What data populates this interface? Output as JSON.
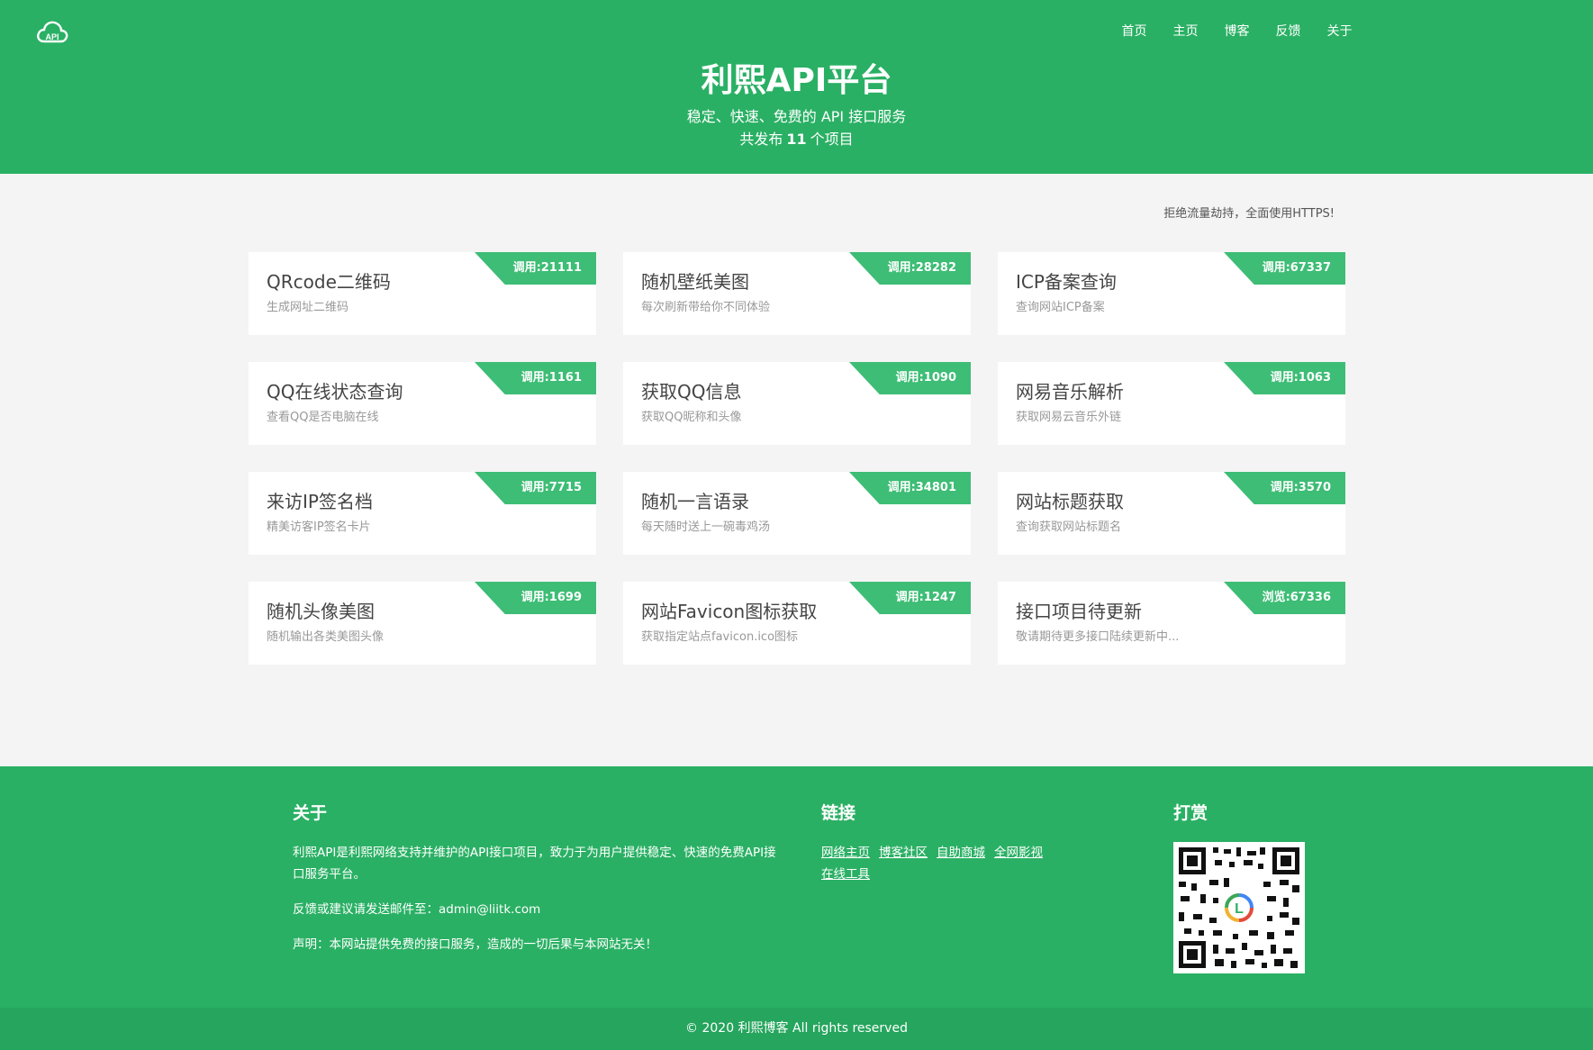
{
  "header": {
    "logo_text": "API",
    "nav": [
      "首页",
      "主页",
      "博客",
      "反馈",
      "关于"
    ],
    "title": "利熙API平台",
    "subtitle": "稳定、快速、免费的 API 接口服务",
    "count_prefix": "共发布",
    "count_value": "11",
    "count_suffix": "个项目"
  },
  "notice": "拒绝流量劫持，全面使用HTTPS!",
  "cards": [
    {
      "name": "QRcode二维码",
      "desc": "生成网址二维码",
      "badge": "调用:21111"
    },
    {
      "name": "随机壁纸美图",
      "desc": "每次刷新带给你不同体验",
      "badge": "调用:28282"
    },
    {
      "name": "ICP备案查询",
      "desc": "查询网站ICP备案",
      "badge": "调用:67337"
    },
    {
      "name": "QQ在线状态查询",
      "desc": "查看QQ是否电脑在线",
      "badge": "调用:1161"
    },
    {
      "name": "获取QQ信息",
      "desc": "获取QQ昵称和头像",
      "badge": "调用:1090"
    },
    {
      "name": "网易音乐解析",
      "desc": "获取网易云音乐外链",
      "badge": "调用:1063"
    },
    {
      "name": "来访IP签名档",
      "desc": "精美访客IP签名卡片",
      "badge": "调用:7715"
    },
    {
      "name": "随机一言语录",
      "desc": "每天随时送上一碗毒鸡汤",
      "badge": "调用:34801"
    },
    {
      "name": "网站标题获取",
      "desc": "查询获取网站标题名",
      "badge": "调用:3570"
    },
    {
      "name": "随机头像美图",
      "desc": "随机输出各类美图头像",
      "badge": "调用:1699"
    },
    {
      "name": "网站Favicon图标获取",
      "desc": "获取指定站点favicon.ico图标",
      "badge": "调用:1247"
    },
    {
      "name": "接口项目待更新",
      "desc": "敬请期待更多接口陆续更新中...",
      "badge": "浏览:67336"
    }
  ],
  "footer": {
    "about_title": "关于",
    "about_text": "利熙API是利熙网络支持并维护的API接口项目，致力于为用户提供稳定、快速的免费API接口服务平台。",
    "feedback": "反馈或建议请发送邮件至：admin@liitk.com",
    "disclaimer": "声明：本网站提供免费的接口服务，造成的一切后果与本网站无关！",
    "links_title": "链接",
    "links": [
      "网络主页",
      "博客社区",
      "自助商城",
      "全网影视",
      "在线工具"
    ],
    "reward_title": "打赏",
    "copyright": "© 2020 利熙博客 All rights reserved"
  },
  "colors": {
    "primary": "#2ab064",
    "badge": "#3dbd75",
    "footer_bottom": "#25a55d"
  }
}
